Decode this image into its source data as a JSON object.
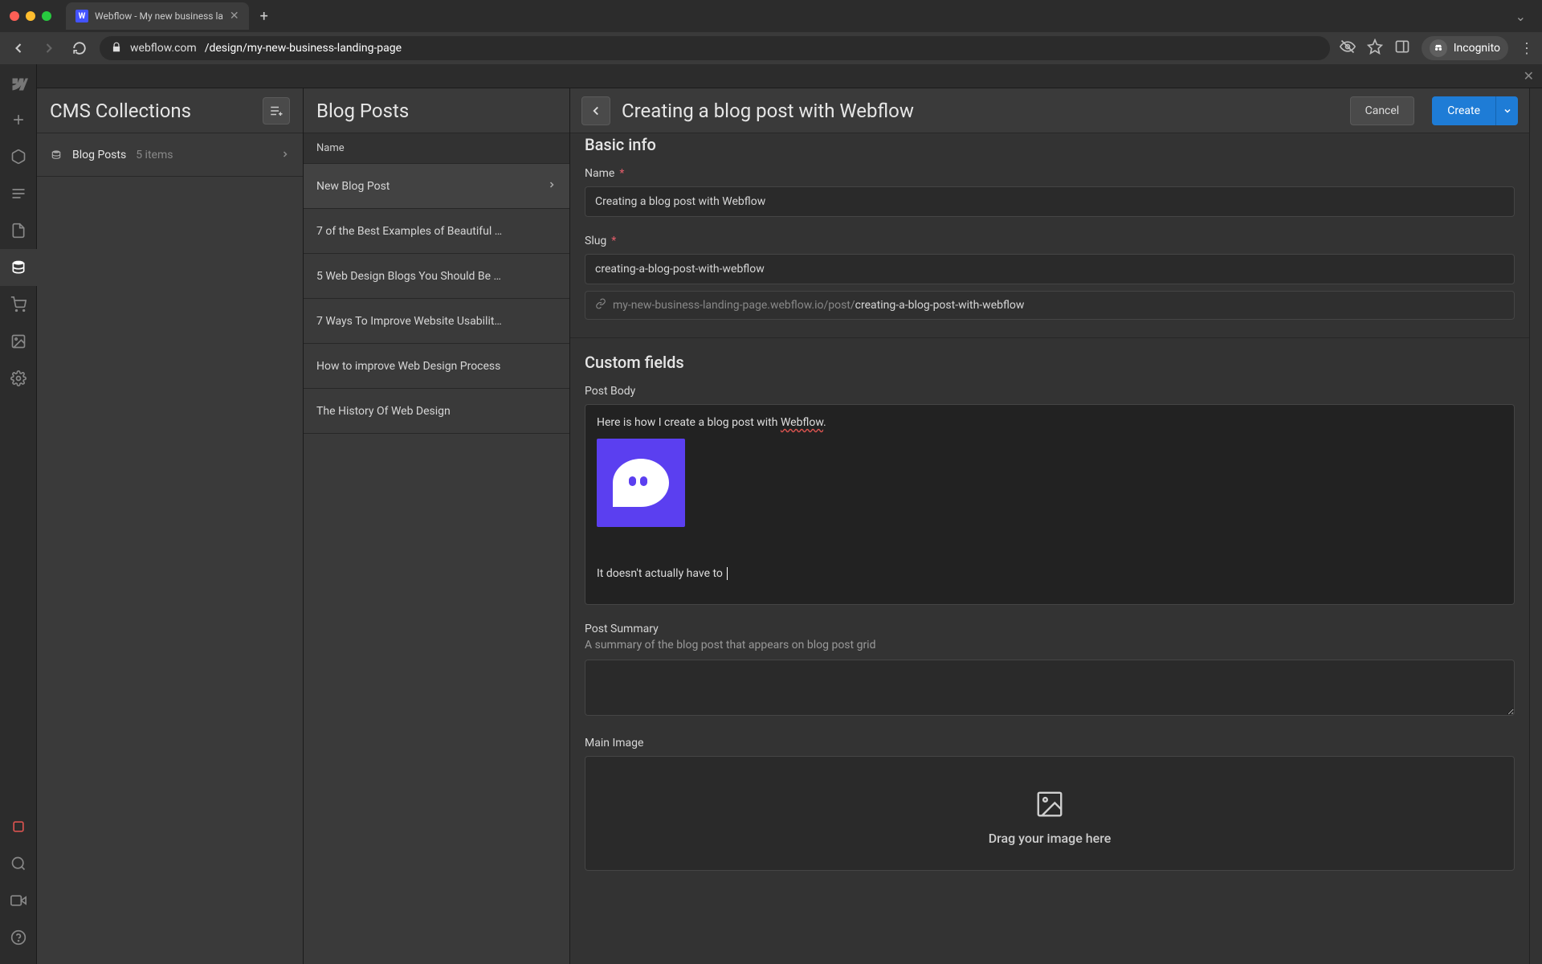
{
  "browser": {
    "tab_title": "Webflow - My new business la",
    "url_prefix": "webflow.com",
    "url_path": "/design/my-new-business-landing-page",
    "incognito_label": "Incognito"
  },
  "collections": {
    "panel_title": "CMS Collections",
    "items": [
      {
        "name": "Blog Posts",
        "count": "5 items"
      }
    ]
  },
  "posts": {
    "panel_title": "Blog Posts",
    "column_header": "Name",
    "items": [
      {
        "title": "New Blog Post",
        "active": true
      },
      {
        "title": "7 of the Best Examples of Beautiful …"
      },
      {
        "title": "5 Web Design Blogs You Should Be …"
      },
      {
        "title": "7 Ways To Improve Website Usabilit…"
      },
      {
        "title": "How to improve Web Design Process"
      },
      {
        "title": "The History Of Web Design"
      }
    ]
  },
  "editor": {
    "heading": "Creating a blog post with Webflow",
    "btn_cancel": "Cancel",
    "btn_create": "Create",
    "sections": {
      "basic_info": "Basic info",
      "custom_fields": "Custom fields"
    },
    "fields": {
      "name": {
        "label": "Name",
        "value": "Creating a blog post with Webflow"
      },
      "slug": {
        "label": "Slug",
        "value": "creating-a-blog-post-with-webflow",
        "url_base": "my-new-business-landing-page.webflow.io/post/",
        "url_slug": "creating-a-blog-post-with-webflow"
      },
      "body": {
        "label": "Post Body",
        "line1_a": "Here is how I create a blog post with ",
        "line1_b": "Webflow",
        "line1_c": ".",
        "line2": "It doesn't actually have to "
      },
      "summary": {
        "label": "Post Summary",
        "help": "A summary of the blog post that appears on blog post grid",
        "value": ""
      },
      "main_image": {
        "label": "Main Image",
        "dropzone_text": "Drag your image here"
      }
    }
  }
}
